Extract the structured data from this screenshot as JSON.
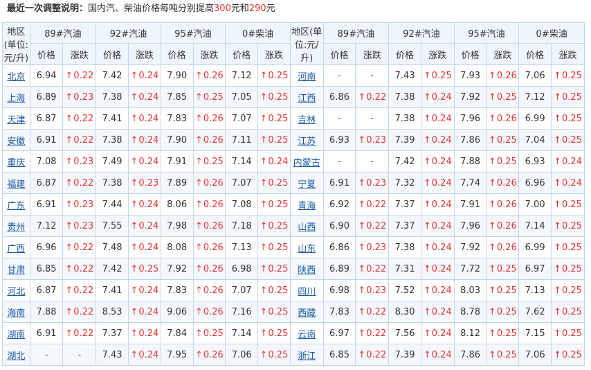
{
  "notice": {
    "label": "最近一次调整说明：",
    "text_before": "国内汽、柴油价格每吨分别提高",
    "gas_increase": "300",
    "middle": "元和",
    "diesel_increase": "290",
    "suffix": "元"
  },
  "header": {
    "region_label": "地区(单位:元/升)",
    "fuels": [
      "89#汽油",
      "92#汽油",
      "95#汽油",
      "0#柴油"
    ],
    "price_label": "价格",
    "change_label": "涨跌",
    "up_arrow": "↑"
  },
  "rows": [
    {
      "left": {
        "region": "北京",
        "v": [
          "6.94",
          "0.22",
          "7.42",
          "0.24",
          "7.90",
          "0.26",
          "7.12",
          "0.25"
        ]
      },
      "right": {
        "region": "河南",
        "v": [
          "-",
          "-",
          "7.43",
          "0.25",
          "7.93",
          "0.26",
          "7.06",
          "0.25"
        ]
      }
    },
    {
      "left": {
        "region": "上海",
        "v": [
          "6.89",
          "0.23",
          "7.38",
          "0.24",
          "7.85",
          "0.25",
          "7.05",
          "0.25"
        ]
      },
      "right": {
        "region": "江西",
        "v": [
          "6.86",
          "0.22",
          "7.38",
          "0.24",
          "7.92",
          "0.25",
          "7.12",
          "0.25"
        ]
      }
    },
    {
      "left": {
        "region": "天津",
        "v": [
          "6.87",
          "0.22",
          "7.41",
          "0.24",
          "7.83",
          "0.26",
          "7.07",
          "0.25"
        ]
      },
      "right": {
        "region": "吉林",
        "v": [
          "-",
          "-",
          "7.38",
          "0.24",
          "7.96",
          "0.26",
          "6.99",
          "0.25"
        ]
      }
    },
    {
      "left": {
        "region": "安徽",
        "v": [
          "6.91",
          "0.22",
          "7.38",
          "0.24",
          "7.90",
          "0.26",
          "7.11",
          "0.25"
        ]
      },
      "right": {
        "region": "江苏",
        "v": [
          "6.93",
          "0.23",
          "7.39",
          "0.24",
          "7.86",
          "0.25",
          "7.04",
          "0.25"
        ]
      }
    },
    {
      "left": {
        "region": "重庆",
        "v": [
          "7.08",
          "0.23",
          "7.49",
          "0.24",
          "7.91",
          "0.25",
          "7.14",
          "0.24"
        ]
      },
      "right": {
        "region": "内蒙古",
        "v": [
          "-",
          "-",
          "7.42",
          "0.24",
          "7.88",
          "0.25",
          "6.93",
          "0.24"
        ]
      }
    },
    {
      "left": {
        "region": "福建",
        "v": [
          "6.87",
          "0.22",
          "7.38",
          "0.23",
          "7.89",
          "0.26",
          "7.07",
          "0.25"
        ]
      },
      "right": {
        "region": "宁夏",
        "v": [
          "6.91",
          "0.23",
          "7.32",
          "0.24",
          "7.74",
          "0.26",
          "6.96",
          "0.24"
        ]
      }
    },
    {
      "left": {
        "region": "广东",
        "v": [
          "6.91",
          "0.23",
          "7.44",
          "0.24",
          "8.06",
          "0.26",
          "7.08",
          "0.25"
        ]
      },
      "right": {
        "region": "青海",
        "v": [
          "6.92",
          "0.22",
          "7.37",
          "0.24",
          "7.91",
          "0.26",
          "7.00",
          "0.25"
        ]
      }
    },
    {
      "left": {
        "region": "贵州",
        "v": [
          "7.12",
          "0.23",
          "7.55",
          "0.24",
          "7.98",
          "0.26",
          "7.18",
          "0.25"
        ]
      },
      "right": {
        "region": "山西",
        "v": [
          "6.90",
          "0.22",
          "7.37",
          "0.24",
          "7.96",
          "0.26",
          "7.14",
          "0.25"
        ]
      }
    },
    {
      "left": {
        "region": "广西",
        "v": [
          "6.96",
          "0.22",
          "7.48",
          "0.24",
          "8.08",
          "0.26",
          "7.13",
          "0.25"
        ]
      },
      "right": {
        "region": "山东",
        "v": [
          "6.86",
          "0.23",
          "7.38",
          "0.24",
          "7.92",
          "0.26",
          "6.99",
          "0.25"
        ]
      }
    },
    {
      "left": {
        "region": "甘肃",
        "v": [
          "6.85",
          "0.22",
          "7.42",
          "0.25",
          "7.92",
          "0.26",
          "6.98",
          "0.25"
        ]
      },
      "right": {
        "region": "陕西",
        "v": [
          "6.89",
          "0.22",
          "7.31",
          "0.24",
          "7.72",
          "0.25",
          "6.97",
          "0.25"
        ]
      }
    },
    {
      "left": {
        "region": "河北",
        "v": [
          "6.87",
          "0.22",
          "7.41",
          "0.24",
          "7.83",
          "0.26",
          "7.07",
          "0.25"
        ]
      },
      "right": {
        "region": "四川",
        "v": [
          "6.98",
          "0.23",
          "7.52",
          "0.24",
          "8.03",
          "0.25",
          "7.13",
          "0.25"
        ]
      }
    },
    {
      "left": {
        "region": "海南",
        "v": [
          "7.88",
          "0.22",
          "8.53",
          "0.24",
          "9.06",
          "0.26",
          "7.16",
          "0.25"
        ]
      },
      "right": {
        "region": "西藏",
        "v": [
          "7.83",
          "0.22",
          "8.30",
          "0.24",
          "8.78",
          "0.25",
          "7.62",
          "0.25"
        ]
      }
    },
    {
      "left": {
        "region": "湖南",
        "v": [
          "6.91",
          "0.22",
          "7.37",
          "0.24",
          "7.84",
          "0.25",
          "7.14",
          "0.25"
        ]
      },
      "right": {
        "region": "云南",
        "v": [
          "6.97",
          "0.22",
          "7.56",
          "0.24",
          "8.12",
          "0.25",
          "7.15",
          "0.25"
        ]
      }
    },
    {
      "left": {
        "region": "湖北",
        "v": [
          "-",
          "-",
          "7.43",
          "0.24",
          "7.95",
          "0.26",
          "7.06",
          "0.25"
        ]
      },
      "right": {
        "region": "浙江",
        "v": [
          "6.85",
          "0.22",
          "7.39",
          "0.24",
          "7.86",
          "0.25",
          "7.06",
          "0.25"
        ]
      }
    }
  ]
}
